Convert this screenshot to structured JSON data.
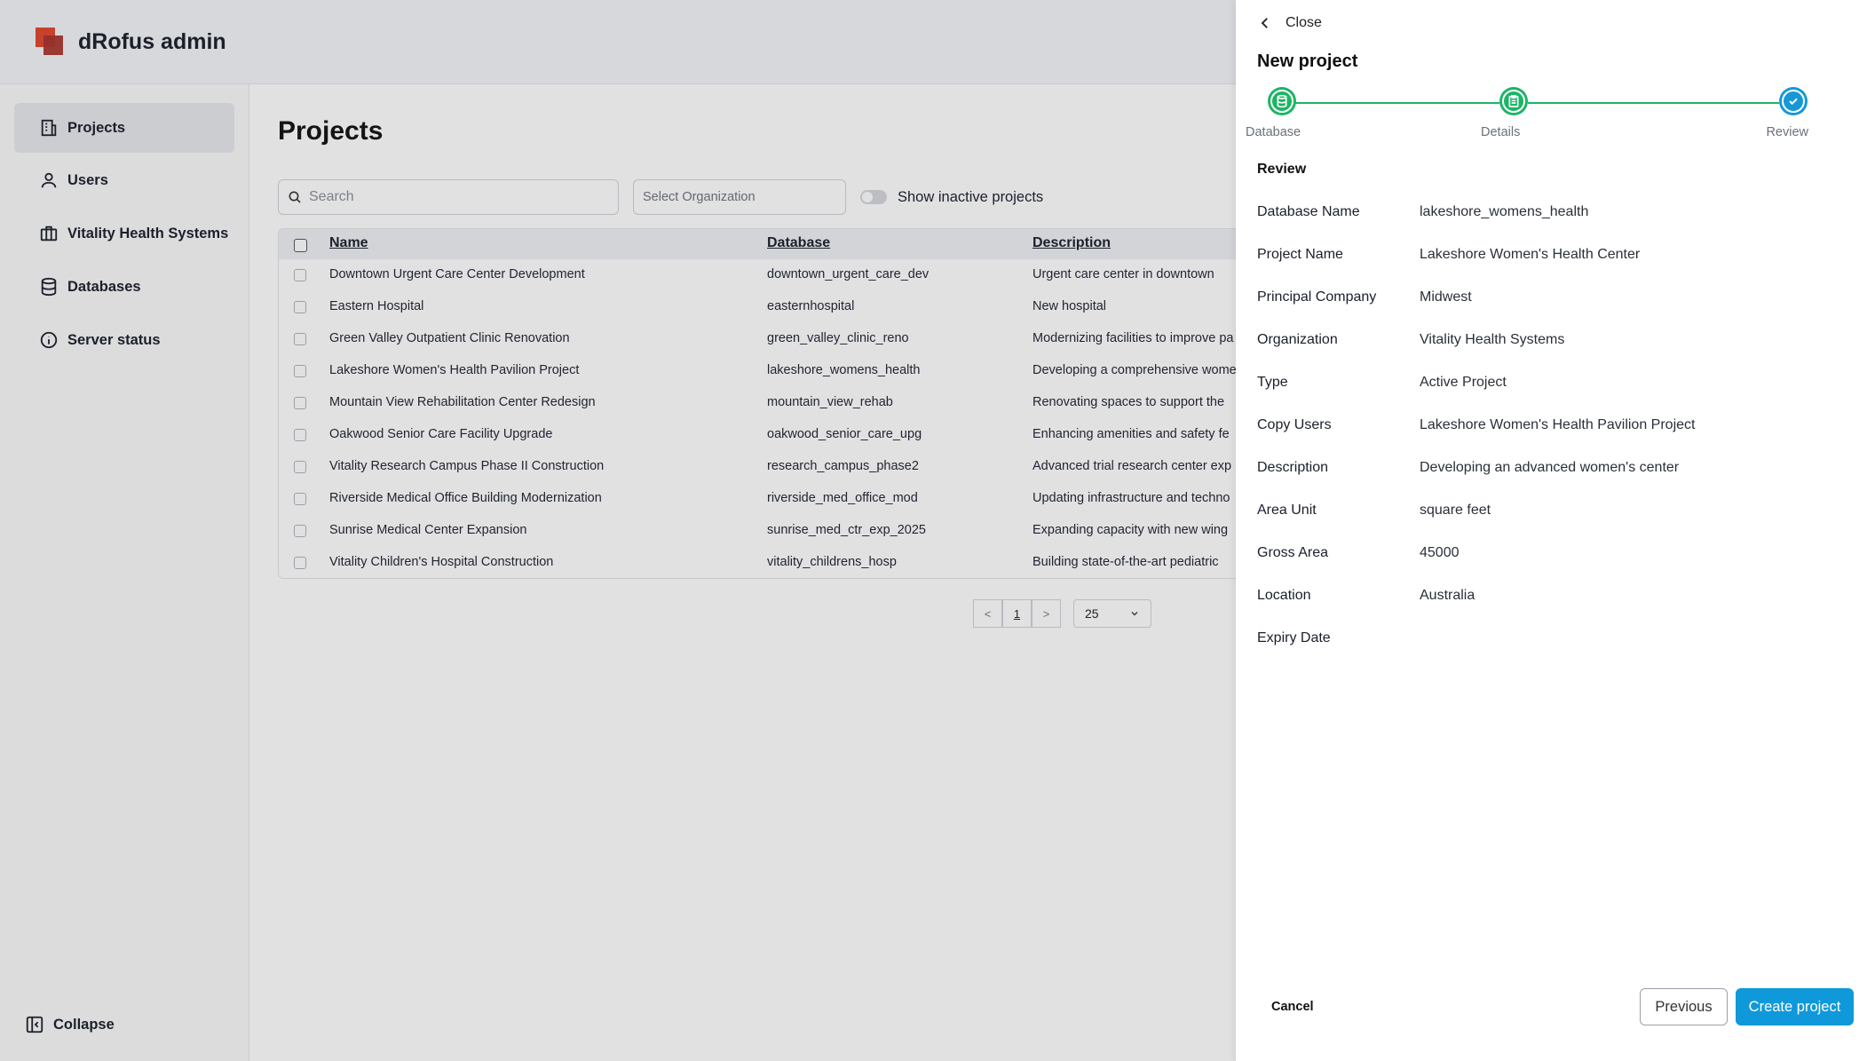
{
  "app": {
    "brand": "dRofus admin",
    "nav": [
      {
        "label": "Projects",
        "icon": "building-icon",
        "active": true
      },
      {
        "label": "Users",
        "icon": "user-icon",
        "active": false
      },
      {
        "label": "Vitality Health Systems",
        "icon": "briefcase-icon",
        "active": false
      },
      {
        "label": "Databases",
        "icon": "database-icon",
        "active": false
      },
      {
        "label": "Server status",
        "icon": "info-icon",
        "active": false
      }
    ],
    "collapse_label": "Collapse"
  },
  "projects_page": {
    "title": "Projects",
    "search_placeholder": "Search",
    "org_placeholder": "Select Organization",
    "inactive_toggle_label": "Show inactive projects",
    "columns": [
      "Name",
      "Database",
      "Description"
    ],
    "rows": [
      {
        "name": "Downtown Urgent Care Center Development",
        "database": "downtown_urgent_care_dev",
        "description": "Urgent care center in downtown"
      },
      {
        "name": "Eastern Hospital",
        "database": "easternhospital",
        "description": "New hospital"
      },
      {
        "name": "Green Valley Outpatient Clinic Renovation",
        "database": "green_valley_clinic_reno",
        "description": "Modernizing facilities to improve pa"
      },
      {
        "name": "Lakeshore Women's Health Pavilion Project",
        "database": "lakeshore_womens_health",
        "description": "Developing a comprehensive wome"
      },
      {
        "name": "Mountain View Rehabilitation Center Redesign",
        "database": "mountain_view_rehab",
        "description": "Renovating spaces to support the"
      },
      {
        "name": "Oakwood Senior Care Facility Upgrade",
        "database": "oakwood_senior_care_upg",
        "description": "Enhancing amenities and safety fe"
      },
      {
        "name": "Vitality Research Campus Phase II Construction",
        "database": "research_campus_phase2",
        "description": "Advanced trial research center exp"
      },
      {
        "name": "Riverside Medical Office Building Modernization",
        "database": "riverside_med_office_mod",
        "description": "Updating infrastructure and techno"
      },
      {
        "name": "Sunrise Medical Center Expansion",
        "database": "sunrise_med_ctr_exp_2025",
        "description": "Expanding capacity with new wing"
      },
      {
        "name": "Vitality Children's Hospital Construction",
        "database": "vitality_childrens_hosp",
        "description": "Building state-of-the-art pediatric"
      }
    ],
    "pagination": {
      "prev": "<",
      "current": "1",
      "next": ">",
      "page_size": "25"
    }
  },
  "panel": {
    "close_label": "Close",
    "title": "New project",
    "steps": [
      {
        "label": "Database",
        "status": "done",
        "icon": "database-icon"
      },
      {
        "label": "Details",
        "status": "done",
        "icon": "clipboard-icon"
      },
      {
        "label": "Review",
        "status": "current",
        "icon": "check-circle-icon"
      }
    ],
    "review_heading": "Review",
    "fields": [
      {
        "key": "Database Name",
        "value": "lakeshore_womens_health"
      },
      {
        "key": "Project Name",
        "value": "Lakeshore Women's Health Center"
      },
      {
        "key": "Principal Company",
        "value": "Midwest"
      },
      {
        "key": "Organization",
        "value": "Vitality Health Systems"
      },
      {
        "key": "Type",
        "value": "Active Project"
      },
      {
        "key": "Copy Users",
        "value": "Lakeshore Women's Health Pavilion Project"
      },
      {
        "key": "Description",
        "value": "Developing an advanced women's center"
      },
      {
        "key": "Area Unit",
        "value": "square feet"
      },
      {
        "key": "Gross Area",
        "value": "45000"
      },
      {
        "key": "Location",
        "value": "Australia"
      },
      {
        "key": "Expiry Date",
        "value": ""
      }
    ],
    "cancel_label": "Cancel",
    "previous_label": "Previous",
    "create_label": "Create project"
  },
  "colors": {
    "success": "#1cb565",
    "primary": "#0f99da",
    "brand_red": "#e2452d"
  }
}
